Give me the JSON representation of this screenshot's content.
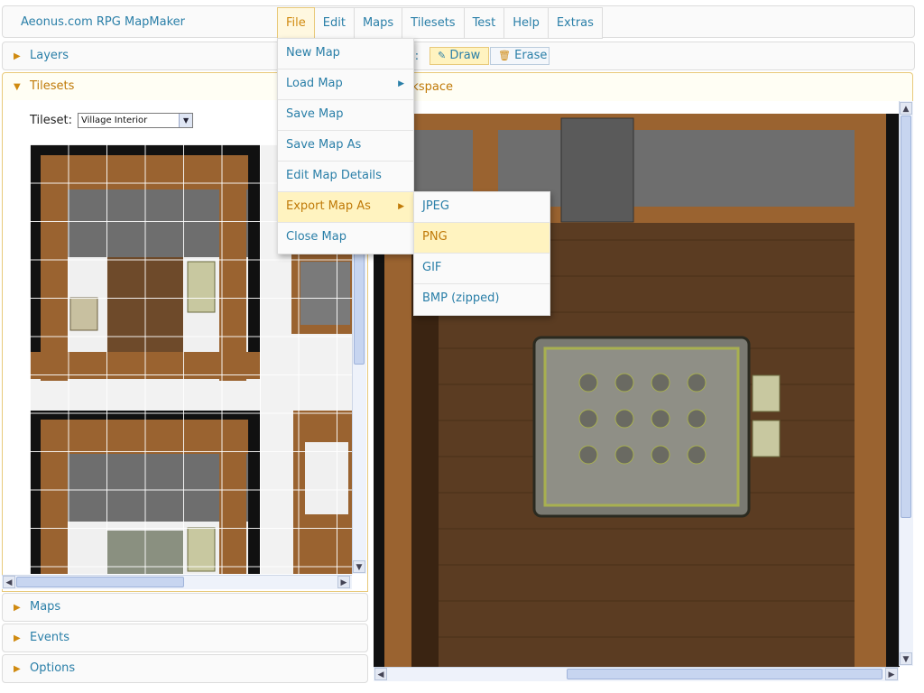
{
  "app": {
    "title": "Aeonus.com RPG MapMaker"
  },
  "menubar": {
    "items": [
      {
        "label": "File",
        "active": true
      },
      {
        "label": "Edit"
      },
      {
        "label": "Maps"
      },
      {
        "label": "Tilesets"
      },
      {
        "label": "Test"
      },
      {
        "label": "Help"
      },
      {
        "label": "Extras"
      }
    ]
  },
  "file_menu": {
    "items": [
      {
        "label": "New Map"
      },
      {
        "label": "Load Map",
        "submenu": true
      },
      {
        "label": "Save Map"
      },
      {
        "label": "Save Map As"
      },
      {
        "label": "Edit Map Details"
      },
      {
        "label": "Export Map As",
        "submenu": true,
        "highlighted": true
      },
      {
        "label": "Close Map"
      }
    ]
  },
  "export_submenu": {
    "items": [
      {
        "label": "JPEG"
      },
      {
        "label": "PNG",
        "highlighted": true
      },
      {
        "label": "GIF"
      },
      {
        "label": "BMP (zipped)"
      }
    ]
  },
  "left_panel": {
    "layers": "Layers",
    "tilesets": "Tilesets",
    "tileset_label": "Tileset:",
    "tileset_selected": "Village Interior",
    "maps": "Maps",
    "events": "Events",
    "options": "Options"
  },
  "toolbar": {
    "tools_label": "s:",
    "draw_label": "Draw",
    "erase_label": "Erase"
  },
  "workspace": {
    "title": "orkspace"
  },
  "colors": {
    "accent": "#2a7fa8",
    "highlight": "#fff3c0",
    "highlight_text": "#c07a08",
    "wood": "#8b5a2b",
    "floor": "#5b3c22"
  }
}
